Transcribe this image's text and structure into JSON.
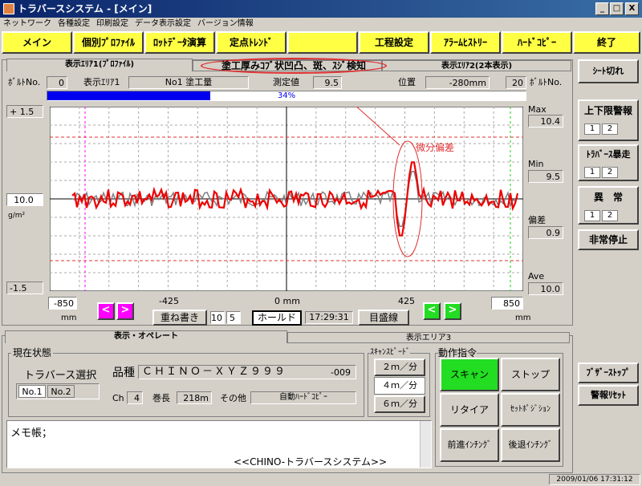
{
  "window": {
    "title": "トラバースシステム - [メイン]",
    "min": "_",
    "max": "□",
    "close": "X"
  },
  "menu": [
    "ネットワーク",
    "各種設定",
    "印刷設定",
    "データ表示設定",
    "バージョン情報"
  ],
  "toolbar": [
    "メイン",
    "個別ﾌﾟﾛﾌｧｲﾙ",
    "ﾛｯﾄﾃﾞｰﾀ演算",
    "定点ﾄﾚﾝﾄﾞ",
    "",
    "工程設定",
    "ｱﾗｰﾑﾋｽﾄﾘｰ",
    "ﾊｰﾄﾞｺﾋﾟｰ",
    "終了"
  ],
  "tabs": {
    "area1": "表示ｴﾘｱ1(ﾌﾟﾛﾌｧｲﾙ)",
    "area_mid": "塗工厚みｺﾌﾞ状凹凸、斑、ｽｼﾞ検知",
    "area2": "表示ｴﾘｱ2(2本表示)"
  },
  "info": {
    "bolt_label_l": "ﾎﾞﾙﾄNo.",
    "bolt_val_l": "0",
    "area_label": "表示ｴﾘｱ1",
    "area_name": "No1 塗工量",
    "meas_label": "測定値",
    "meas_val": "9.5",
    "pos_label": "位置",
    "pos_val": "-280mm",
    "bolt_val_r": "20",
    "bolt_label_r": "ﾎﾞﾙﾄNo."
  },
  "progress": {
    "value": 0.34,
    "text": "34%"
  },
  "yaxis": {
    "top": "+ 1.5",
    "mid": "10.0",
    "unit": "g/m²",
    "bottom": "-1.5"
  },
  "stats": {
    "max_label": "Max",
    "max_val": "10.4",
    "min_label": "Min",
    "min_val": "9.5",
    "dev_label": "偏差",
    "dev_val": "0.9",
    "ave_label": "Ave",
    "ave_val": "10.0"
  },
  "annotation": "微分偏差",
  "xaxis": {
    "left_val": "-850",
    "left_unit": "mm",
    "t1": "-425",
    "t2": "0 mm",
    "t3": "425",
    "right_val": "850",
    "right_unit": "mm"
  },
  "controls": {
    "overwrite": "重ね書き",
    "ow_a": "10",
    "ow_b": "5",
    "hold": "ホールド",
    "time": "17:29:31",
    "scale": "目盛線",
    "left_arrow": "<",
    "right_arrow": ">"
  },
  "side": {
    "sheet_break": "ｼｰﾄ切れ",
    "limit_alarm": "上下限警報",
    "traverse_runaway": "ﾄﾗﾊﾞｰｽ暴走",
    "abnormal": "異　常",
    "emergency": "非常停止",
    "buzzer_stop": "ﾌﾞｻﾞｰｽﾄｯﾌﾟ",
    "alarm_reset": "警報ﾘｾｯﾄ",
    "one": "1",
    "two": "2"
  },
  "lower_tabs": {
    "operate": "表示・オペレート",
    "area3": "表示エリア3"
  },
  "status": {
    "group": "現在状態",
    "traverse_select": "トラバース選択",
    "no1": "No.1",
    "no2": "No.2",
    "product_label": "品種",
    "product_val": "ＣＨＩＮＯ－ＸＹＺ９９９",
    "product_num": "-009",
    "ch_label": "Ch",
    "ch_val": "4",
    "roll_label": "巻長",
    "roll_val": "218m",
    "other_label": "その他",
    "other_val": "自動ﾊｰﾄﾞｺﾋﾟｰ"
  },
  "speed": {
    "group": "ｽｷｬﾝｽﾋﾟｰﾄﾞ",
    "s1": "２ｍ／分",
    "s2": "４ｍ／分",
    "s3": "６ｍ／分"
  },
  "action": {
    "group": "動作指令",
    "scan": "スキャン",
    "stop": "ストップ",
    "retire": "リタイア",
    "set_pos": "ｾｯﾄﾎﾟｼﾞｼｮﾝ",
    "fwd_inch": "前進ｲﾝﾁﾝｸﾞ",
    "back_inch": "後退ｲﾝﾁﾝｸﾞ"
  },
  "memo": {
    "label": "メモ帳；",
    "footer": "<<CHINO-トラバースシステム>>"
  },
  "statusbar": "2009/01/06  17:31:12",
  "colors": {
    "accent": "#ffff44",
    "scan": "#22dd22",
    "arrow": "#ff00ff",
    "trace": "#ee0000",
    "progress": "#0000ee"
  },
  "chart_data": {
    "type": "line",
    "x_range": [
      -850,
      850
    ],
    "y_range": [
      -1.5,
      1.5
    ],
    "grid": true,
    "series": [
      {
        "color": "red"
      },
      {
        "color": "gray"
      }
    ]
  }
}
